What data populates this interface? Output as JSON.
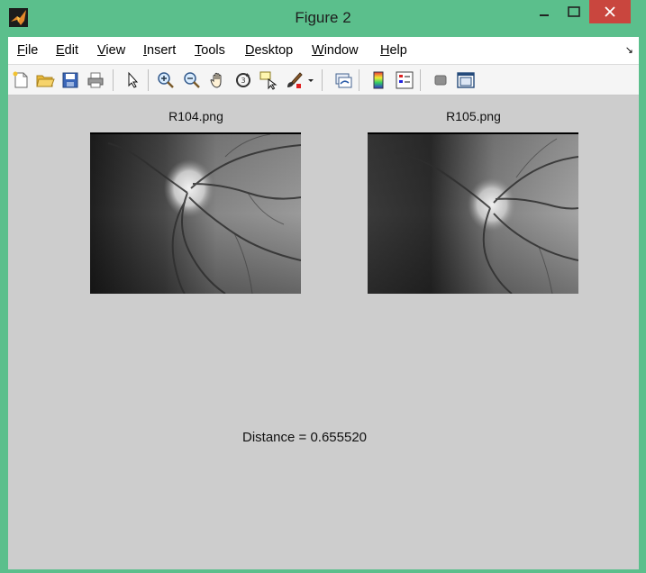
{
  "window": {
    "title": "Figure 2"
  },
  "menu": {
    "items": [
      {
        "ul": "F",
        "rest": "ile"
      },
      {
        "ul": "E",
        "rest": "dit"
      },
      {
        "ul": "V",
        "rest": "iew"
      },
      {
        "ul": "I",
        "rest": "nsert"
      },
      {
        "ul": "T",
        "rest": "ools"
      },
      {
        "ul": "D",
        "rest": "esktop"
      },
      {
        "ul": "W",
        "rest": "indow"
      },
      {
        "ul": "H",
        "rest": "elp"
      }
    ],
    "arrow": "↘"
  },
  "toolbar": {
    "icons": [
      "new-figure-icon",
      "open-file-icon",
      "save-icon",
      "print-icon",
      "edit-plot-icon",
      "zoom-in-icon",
      "zoom-out-icon",
      "pan-hand-icon",
      "rotate-3d-icon",
      "data-cursor-icon",
      "brush-icon",
      "brush-dropdown-icon",
      "link-plot-icon",
      "colorbar-icon",
      "legend-icon",
      "hide-plot-tools-icon",
      "show-plot-tools-icon"
    ]
  },
  "figure": {
    "images": [
      {
        "title": "R104.png"
      },
      {
        "title": "R105.png"
      }
    ],
    "distance_text": "Distance = 0.655520"
  },
  "colors": {
    "titlebar": "#5bbf8c",
    "close": "#c9463e",
    "figure_bg": "#cdcdcd"
  }
}
